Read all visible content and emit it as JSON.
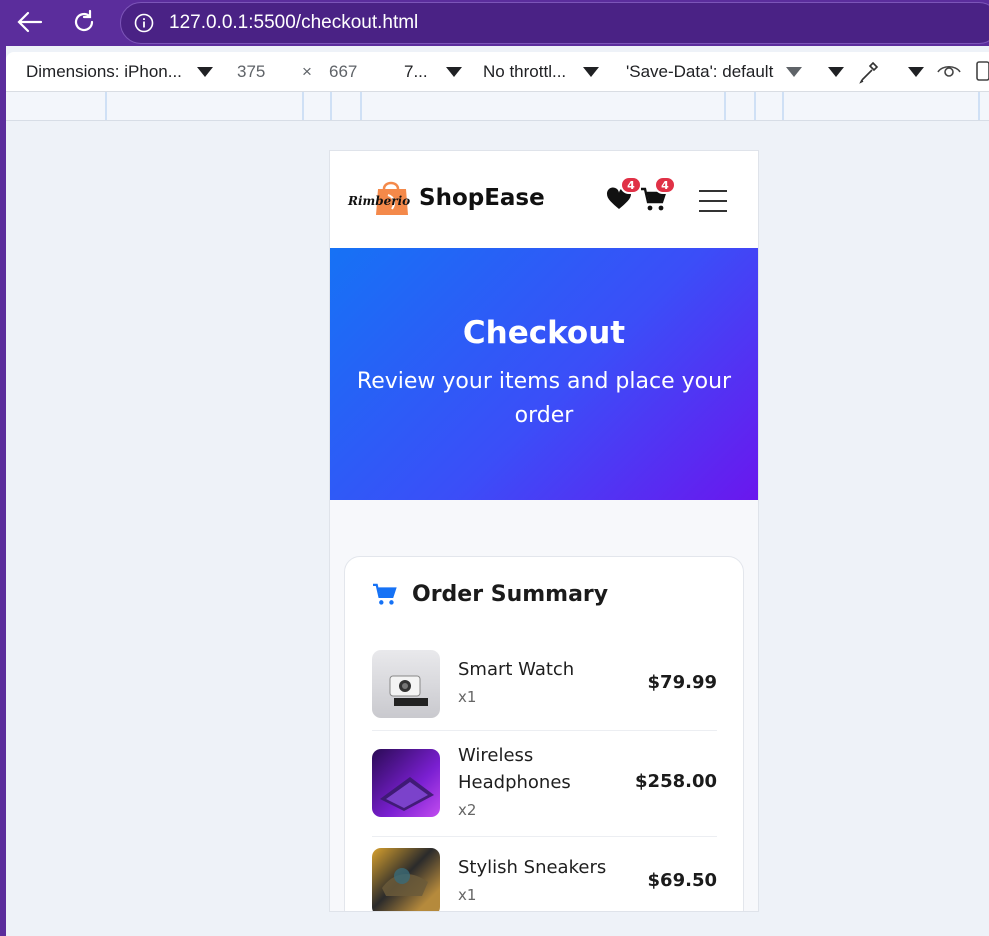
{
  "browser": {
    "url": "127.0.0.1:5500/checkout.html"
  },
  "devtools": {
    "dimensions": "Dimensions: iPhon...",
    "width": "375",
    "times": "×",
    "height": "667",
    "zoom": "7...",
    "throttling": "No throttl...",
    "save_data": "'Save-Data': default"
  },
  "site": {
    "brand": "ShopEase",
    "logo_text": "Rimberio",
    "wishlist_count": "4",
    "cart_count": "4"
  },
  "hero": {
    "title": "Checkout",
    "subtitle": "Review your items and place your order"
  },
  "order_summary": {
    "title": "Order Summary",
    "items": [
      {
        "name": "Smart Watch",
        "qty": "x1",
        "price": "$79.99"
      },
      {
        "name": "Wireless Headphones",
        "qty": "x2",
        "price": "$258.00"
      },
      {
        "name": "Stylish Sneakers",
        "qty": "x1",
        "price": "$69.50"
      }
    ]
  },
  "colors": {
    "accent": "#1672f5",
    "badge": "#e03146",
    "chrome": "#5b2d9c"
  }
}
